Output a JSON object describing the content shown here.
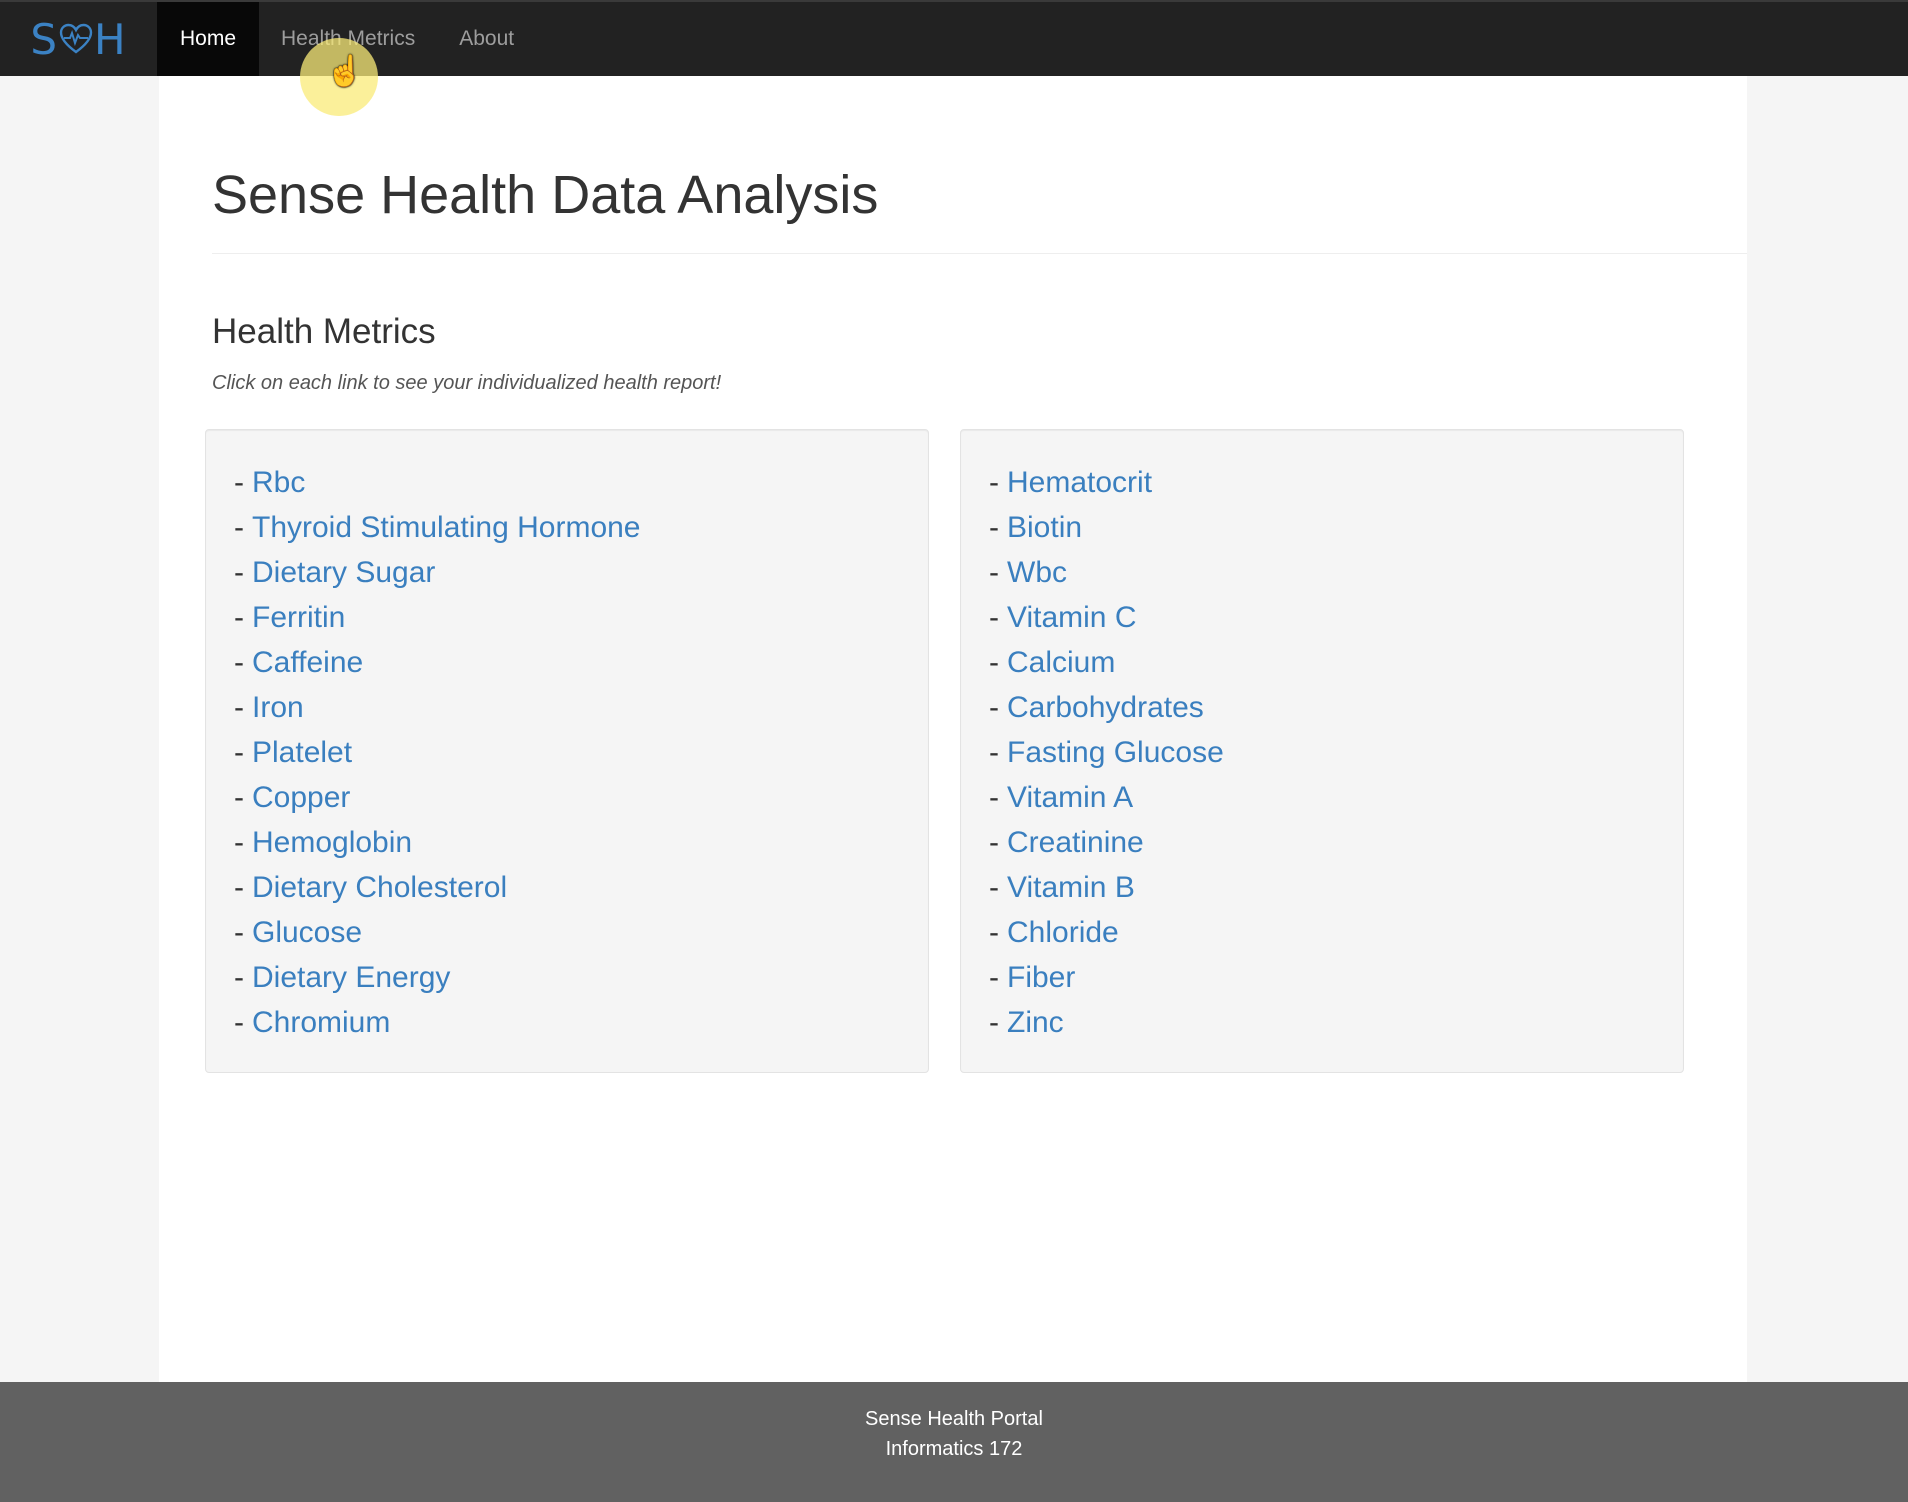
{
  "navbar": {
    "brand": {
      "prefix": "S",
      "suffix": "H",
      "icon": "heart-pulse-icon"
    },
    "items": [
      {
        "label": "Home",
        "active": true
      },
      {
        "label": "Health Metrics",
        "active": false
      },
      {
        "label": "About",
        "active": false
      }
    ]
  },
  "main": {
    "title": "Sense Health Data Analysis",
    "section_heading": "Health Metrics",
    "section_subtitle": "Click on each link to see your individualized health report!",
    "left_metrics": [
      "Rbc",
      "Thyroid Stimulating Hormone",
      "Dietary Sugar",
      "Ferritin",
      "Caffeine",
      "Iron",
      "Platelet",
      "Copper",
      "Hemoglobin",
      "Dietary Cholesterol",
      "Glucose",
      "Dietary Energy",
      "Chromium"
    ],
    "right_metrics": [
      "Hematocrit",
      "Biotin",
      "Wbc",
      "Vitamin C",
      "Calcium",
      "Carbohydrates",
      "Fasting Glucose",
      "Vitamin A",
      "Creatinine",
      "Vitamin B",
      "Chloride",
      "Fiber",
      "Zinc"
    ],
    "item_prefix": "-"
  },
  "footer": {
    "line1": "Sense Health Portal",
    "line2": "Informatics 172"
  },
  "colors": {
    "brand": "#3b82c4",
    "link": "#3a7fbf",
    "navbar": "#222222",
    "footer": "#616161"
  }
}
